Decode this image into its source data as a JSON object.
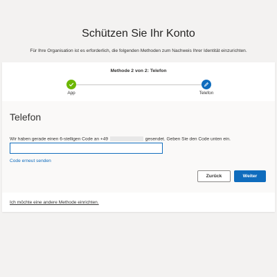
{
  "page": {
    "title": "Schützen Sie Ihr Konto",
    "subtitle": "Für Ihre Organisation ist es erforderlich, die folgenden Methoden zum Nachweis Ihrer Identität einzurichten."
  },
  "wizard": {
    "step_title": "Methode 2 von 2: Telefon",
    "steps": [
      {
        "label": "App",
        "status": "completed",
        "icon": "checkmark-icon",
        "color": "#6bb700"
      },
      {
        "label": "Telefon",
        "status": "current",
        "icon": "pencil-icon",
        "color": "#0f6cbd"
      }
    ]
  },
  "phone": {
    "heading": "Telefon",
    "instruction_prefix": "Wir haben gerade einen 6-stelligen Code an +49",
    "instruction_suffix": "gesendet. Geben Sie den Code unten ein.",
    "code_value": "",
    "resend_label": "Code erneut senden",
    "back_label": "Zurück",
    "next_label": "Weiter"
  },
  "footer": {
    "alt_method_label": "Ich möchte eine andere Methode einrichten."
  },
  "colors": {
    "accent": "#0f6cbd",
    "success": "#6bb700",
    "background": "#f3f2f1"
  }
}
